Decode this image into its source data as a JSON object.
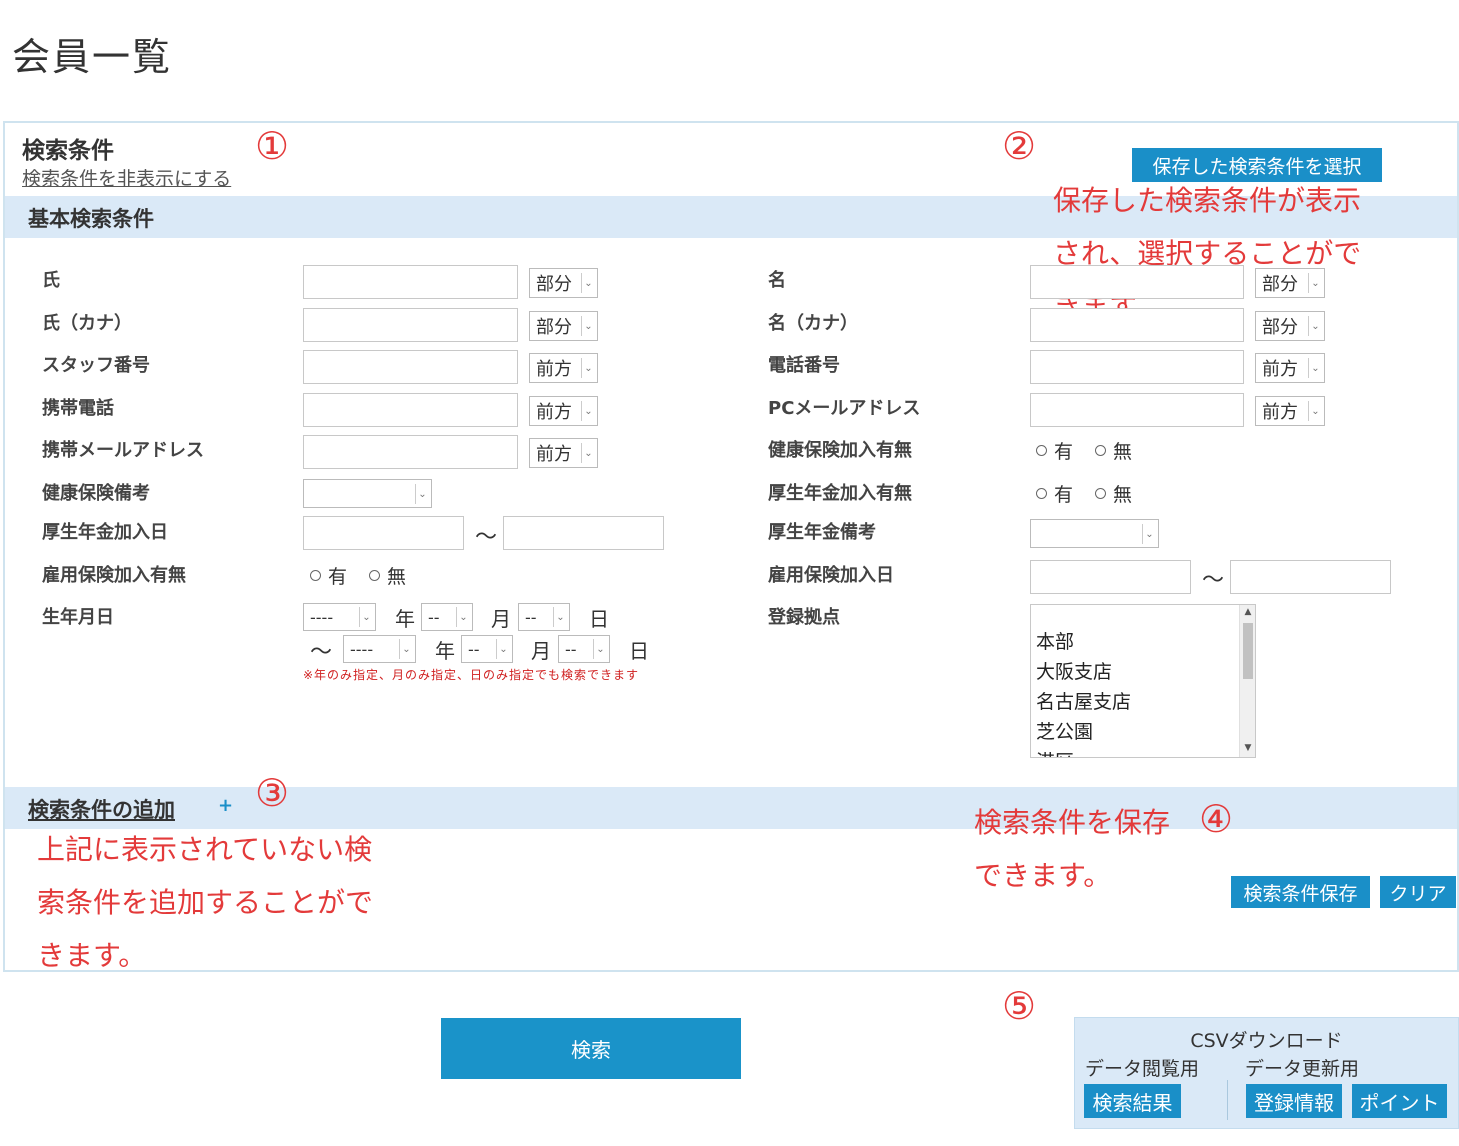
{
  "page_title": "会員一覧",
  "search_panel": {
    "title": "検索条件",
    "hide_link": "検索条件を非表示にする",
    "saved_conditions_button": "保存した検索条件を選択"
  },
  "basic_section": {
    "title": "基本検索条件"
  },
  "fields_left": [
    {
      "label": "氏",
      "match": "部分"
    },
    {
      "label": "氏（カナ）",
      "match": "部分"
    },
    {
      "label": "スタッフ番号",
      "match": "前方"
    },
    {
      "label": "携帯電話",
      "match": "前方"
    },
    {
      "label": "携帯メールアドレス",
      "match": "前方"
    },
    {
      "label": "健康保険備考"
    },
    {
      "label": "厚生年金加入日",
      "tilde": "～"
    },
    {
      "label": "雇用保険加入有無"
    },
    {
      "label": "生年月日"
    }
  ],
  "fields_right": [
    {
      "label": "名",
      "match": "部分"
    },
    {
      "label": "名（カナ）",
      "match": "部分"
    },
    {
      "label": "電話番号",
      "match": "前方"
    },
    {
      "label": "PCメールアドレス",
      "match": "前方"
    },
    {
      "label": "健康保険加入有無"
    },
    {
      "label": "厚生年金加入有無"
    },
    {
      "label": "厚生年金備考"
    },
    {
      "label": "雇用保険加入日",
      "tilde": "～"
    },
    {
      "label": "登録拠点"
    }
  ],
  "radio_options": {
    "yes": "有",
    "no": "無"
  },
  "birthdate": {
    "year_placeholder": "----",
    "month_placeholder": "--",
    "day_placeholder": "--",
    "year_unit": "年",
    "month_unit": "月",
    "day_unit": "日",
    "range_tilde": "～",
    "note": "※年のみ指定、月のみ指定、日のみ指定でも検索できます"
  },
  "locations": [
    "本部",
    "大阪支店",
    "名古屋支店",
    "芝公園",
    "港区"
  ],
  "add_section": {
    "title": "検索条件の追加",
    "plus": "+"
  },
  "actions": {
    "save_conditions": "検索条件保存",
    "clear": "クリア",
    "search": "検索"
  },
  "csv": {
    "title": "CSVダウンロード",
    "view_label": "データ閲覧用",
    "update_label": "データ更新用",
    "search_results": "検索結果",
    "registration_info": "登録情報",
    "points": "ポイント"
  },
  "annotations": {
    "n1": "①",
    "n2": "②",
    "n3": "③",
    "n4": "④",
    "n5": "⑤",
    "a2_line1": "保存した検索条件が表示",
    "a2_line2": "され、選択することがで",
    "a2_line3": "きます。",
    "a3_line1": "上記に表示されていない検",
    "a3_line2": "索条件を追加することがで",
    "a3_line3": "きます。",
    "a4_line1": "検索条件を保存",
    "a4_line2": "できます。"
  },
  "colors": {
    "accent": "#1a8fc8",
    "band": "#dae9f7",
    "annotation": "#e33a3a"
  }
}
